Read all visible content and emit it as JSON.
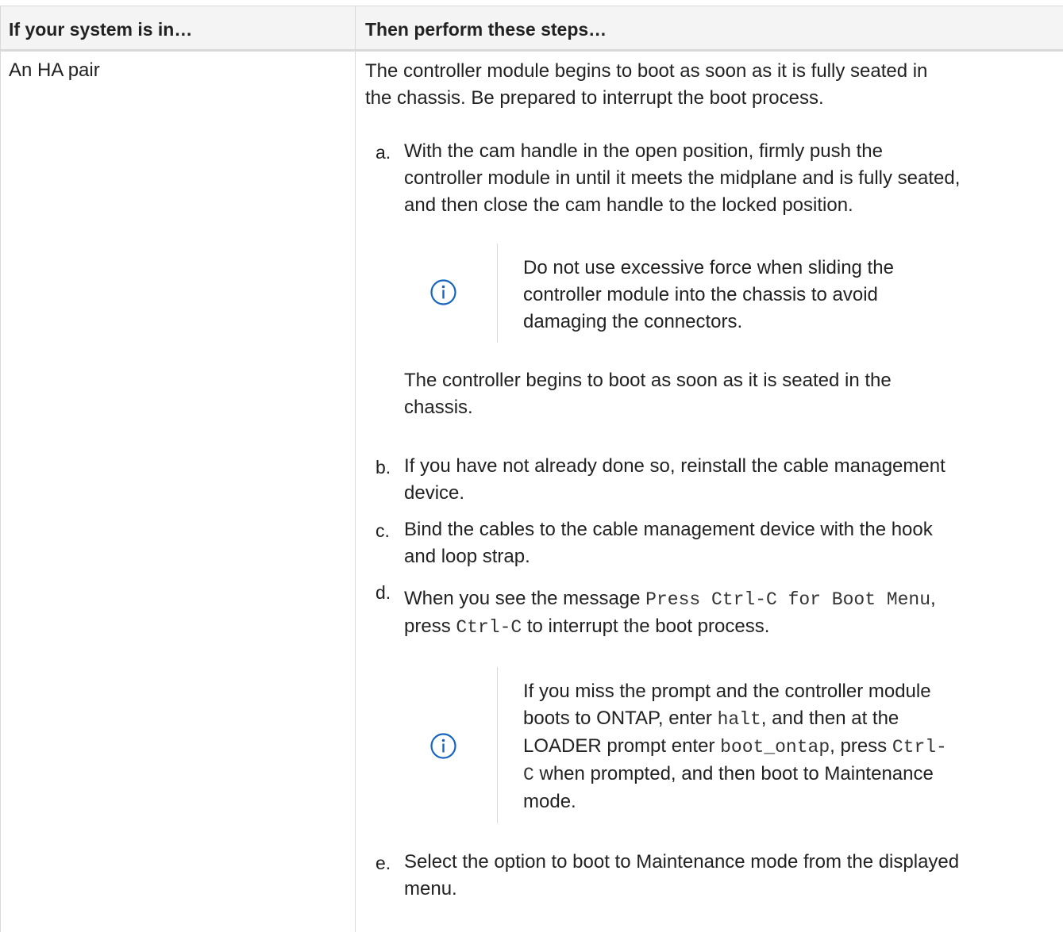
{
  "header": {
    "col1": "If your system is in…",
    "col2": "Then perform these steps…"
  },
  "row": {
    "system": "An HA pair",
    "intro": [
      "The controller module begins to boot as soon as it is fully seated in",
      "the chassis. Be prepared to interrupt the boot process."
    ],
    "step_a": {
      "marker": "a.",
      "lines": [
        "With the cam handle in the open position, firmly push the",
        "controller module in until it meets the midplane and is fully seated,",
        "and then close the cam handle to the locked position."
      ]
    },
    "note_1": {
      "icon": "info-icon",
      "lines": [
        "Do not use excessive force when sliding the",
        "controller module into the chassis to avoid",
        "damaging the connectors."
      ]
    },
    "after_a": [
      "The controller begins to boot as soon as it is seated in the",
      "chassis."
    ],
    "step_b": {
      "marker": "b.",
      "lines": [
        "If you have not already done so, reinstall the cable management",
        "device."
      ]
    },
    "step_c": {
      "marker": "c.",
      "lines": [
        "Bind the cables to the cable management device with the hook",
        "and loop strap."
      ]
    },
    "step_d": {
      "marker": "d.",
      "l1_pre": "When you see the message ",
      "l1_code": "Press Ctrl-C for Boot Menu",
      "l1_post": ",",
      "l2_pre": "press ",
      "l2_code": "Ctrl-C",
      "l2_post": " to interrupt the boot process."
    },
    "note_2": {
      "icon": "info-icon",
      "l1": "If you miss the prompt and the controller module",
      "l2_pre": "boots to ONTAP, enter ",
      "l2_code": "halt",
      "l2_post": ", and then at the",
      "l3_pre": "LOADER prompt enter ",
      "l3_code": "boot_ontap",
      "l3_mid": ", press ",
      "l3_code2": "Ctrl-",
      "l4_code": "C",
      "l4_post": " when prompted, and then boot to Maintenance",
      "l5": "mode."
    },
    "step_e": {
      "marker": "e.",
      "lines": [
        "Select the option to boot to Maintenance mode from the displayed",
        "menu."
      ]
    }
  },
  "colors": {
    "info_icon": "#1565c0",
    "border": "#d9d9d9",
    "header_bg": "#f4f4f4"
  }
}
